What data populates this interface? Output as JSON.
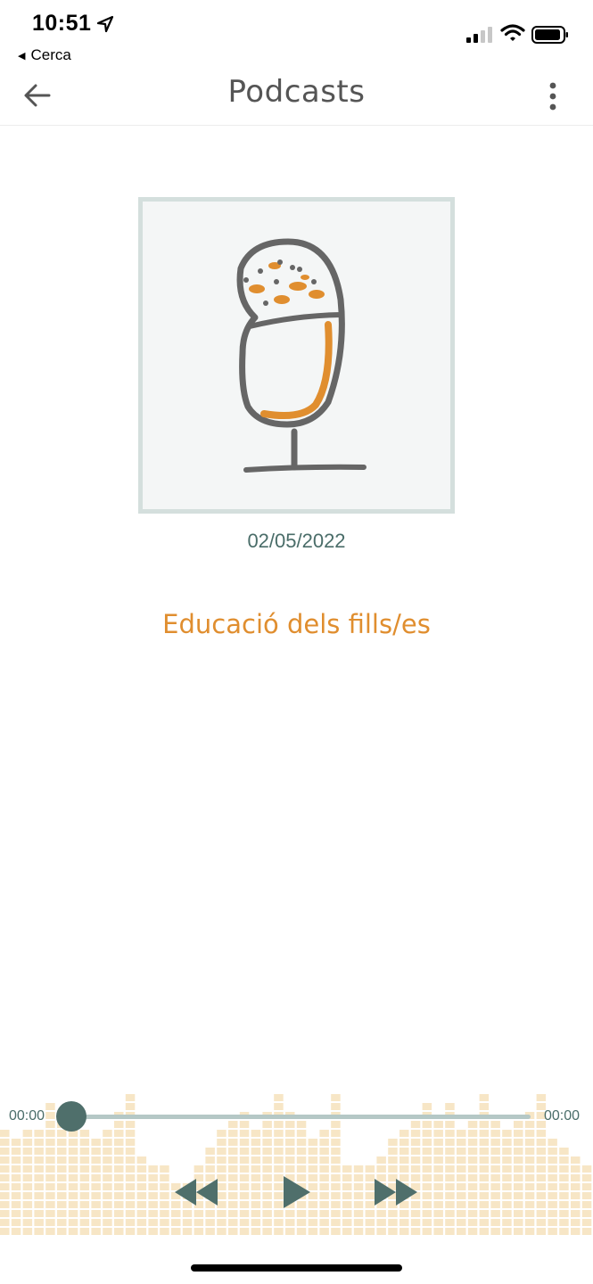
{
  "status_bar": {
    "time": "10:51",
    "back_app_label": "Cerca",
    "icons": [
      "location-arrow-icon",
      "cellular-signal-icon",
      "wifi-icon",
      "battery-icon"
    ]
  },
  "header": {
    "title": "Podcasts",
    "icons": [
      "back-arrow-icon",
      "more-vertical-icon"
    ]
  },
  "episode": {
    "cover_icon": "microphone-illustration",
    "date": "02/05/2022",
    "title": "Educació dels fills/es"
  },
  "player": {
    "current_time": "00:00",
    "total_time": "00:00",
    "progress": 0,
    "controls": [
      "rewind-icon",
      "play-icon",
      "fast-forward-icon"
    ]
  },
  "colors": {
    "accent_orange": "#e08e2f",
    "teal": "#4a6d69",
    "title_gray": "#555555",
    "equalizer": "#f7e6c6"
  }
}
